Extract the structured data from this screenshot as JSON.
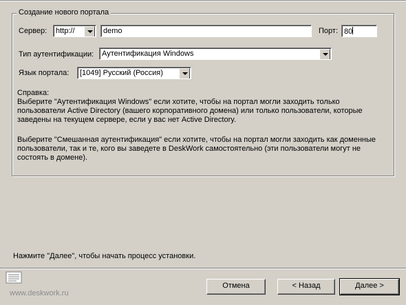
{
  "group": {
    "title": "Создание нового портала"
  },
  "server": {
    "label": "Сервер:",
    "protocol": "http://",
    "host": "demo",
    "port_label": "Порт:",
    "port": "80"
  },
  "auth": {
    "label": "Тип аутентификации:",
    "value": "Аутентификация Windows"
  },
  "language": {
    "label": "Язык портала:",
    "value": "[1049] Русский (Россия)"
  },
  "help": {
    "heading": "Справка:",
    "para1": "Выберите \"Аутентификация Windows\" если хотите, чтобы на портал могли заходить только пользователи Active Directory (вашего корпоративного домена) или только пользователи, которые заведены на текущем сервере, если у вас нет Active Directory.",
    "para2": "Выберите \"Смешанная аутентификация\" если хотите, чтобы на портал могли заходить как доменные пользователи, так и те, кого вы заведете в DeskWork самостоятельно (эти пользователи могут не состоять в домене)."
  },
  "footer": {
    "hint": "Нажмите \"Далее\", чтобы начать процесс установки.",
    "site": "www.deskwork.ru",
    "cancel": "Отмена",
    "back": "< Назад",
    "next": "Далее >"
  }
}
